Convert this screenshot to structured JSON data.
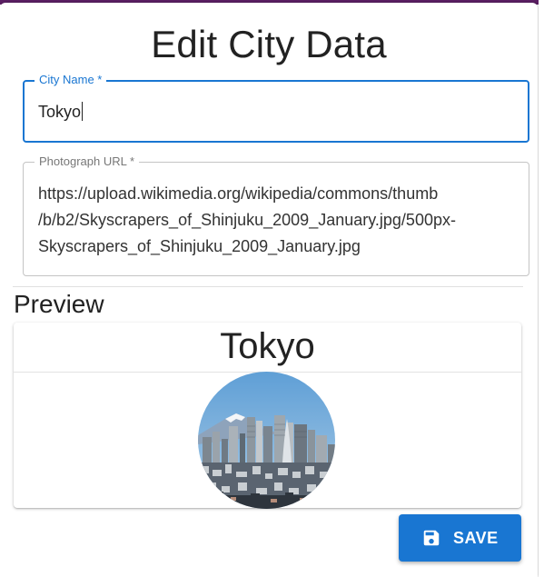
{
  "dialog": {
    "title": "Edit City Data"
  },
  "form": {
    "city_name": {
      "label": "City Name *",
      "value": "Tokyo"
    },
    "photo_url": {
      "label": "Photograph URL *",
      "value": "https://upload.wikimedia.org/wikipedia/commons/thumb\n/b/b2/Skyscrapers_of_Shinjuku_2009_January.jpg/500px-\nSkyscrapers_of_Shinjuku_2009_January.jpg"
    }
  },
  "preview": {
    "heading": "Preview",
    "card_title": "Tokyo",
    "photo_icon": "city-skyline-photo"
  },
  "actions": {
    "save_label": "SAVE",
    "save_icon": "floppy-disk-icon"
  },
  "colors": {
    "accent": "#1976d2",
    "top_strip": "#5b1f63"
  }
}
